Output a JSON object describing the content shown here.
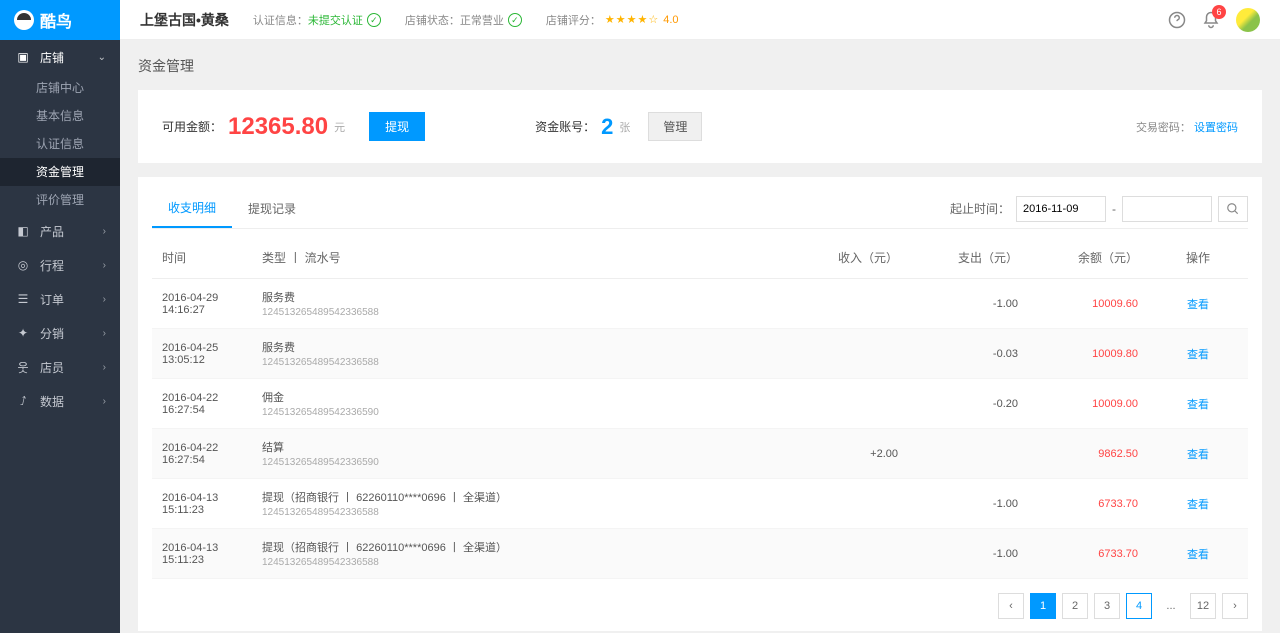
{
  "logo": "酷鸟",
  "sidebar": {
    "shop": {
      "label": "店铺",
      "open": true,
      "items": [
        "店铺中心",
        "基本信息",
        "认证信息",
        "资金管理",
        "评价管理"
      ]
    },
    "product": "产品",
    "trip": "行程",
    "order": "订单",
    "dist": "分销",
    "staff": "店员",
    "data": "数据"
  },
  "header": {
    "shop_name": "上堡古国•黄桑",
    "auth_label": "认证信息：",
    "auth_value": "未提交认证",
    "status_label": "店铺状态：",
    "status_value": "正常营业",
    "rating_label": "店铺评分：",
    "rating_value": "4.0",
    "notification_count": "6"
  },
  "page": {
    "title": "资金管理"
  },
  "summary": {
    "amount_label": "可用金额：",
    "amount": "12365.80",
    "amount_unit": "元",
    "withdraw_btn": "提现",
    "account_label": "资金账号：",
    "account_count": "2",
    "account_unit": "张",
    "manage_btn": "管理",
    "pwd_label": "交易密码：",
    "pwd_link": "设置密码"
  },
  "tabs": {
    "t1": "收支明细",
    "t2": "提现记录"
  },
  "filter": {
    "label": "起止时间：",
    "from": "2016-11-09",
    "to": ""
  },
  "table": {
    "headers": {
      "time": "时间",
      "type": "类型 丨 流水号",
      "income": "收入（元）",
      "expense": "支出（元）",
      "balance": "余额（元）",
      "op": "操作"
    },
    "view": "查看",
    "rows": [
      {
        "date": "2016-04-29",
        "time": "14:16:27",
        "type": "服务费",
        "serial": "124513265489542336588",
        "income": "",
        "expense": "-1.00",
        "balance": "10009.60"
      },
      {
        "date": "2016-04-25",
        "time": "13:05:12",
        "type": "服务费",
        "serial": "124513265489542336588",
        "income": "",
        "expense": "-0.03",
        "balance": "10009.80"
      },
      {
        "date": "2016-04-22",
        "time": "16:27:54",
        "type": "佣金",
        "serial": "124513265489542336590",
        "income": "",
        "expense": "-0.20",
        "balance": "10009.00"
      },
      {
        "date": "2016-04-22",
        "time": "16:27:54",
        "type": "结算",
        "serial": "124513265489542336590",
        "income": "+2.00",
        "expense": "",
        "balance": "9862.50"
      },
      {
        "date": "2016-04-13",
        "time": "15:11:23",
        "type": "提现（招商银行 丨 62260110****0696 丨 全渠道）",
        "serial": "124513265489542336588",
        "income": "",
        "expense": "-1.00",
        "balance": "6733.70"
      },
      {
        "date": "2016-04-13",
        "time": "15:11:23",
        "type": "提现（招商银行 丨 62260110****0696 丨 全渠道）",
        "serial": "124513265489542336588",
        "income": "",
        "expense": "-1.00",
        "balance": "6733.70"
      }
    ]
  },
  "pagination": {
    "pages": [
      "1",
      "2",
      "3",
      "4"
    ],
    "last": "12",
    "active": "1",
    "outlined": "4"
  }
}
